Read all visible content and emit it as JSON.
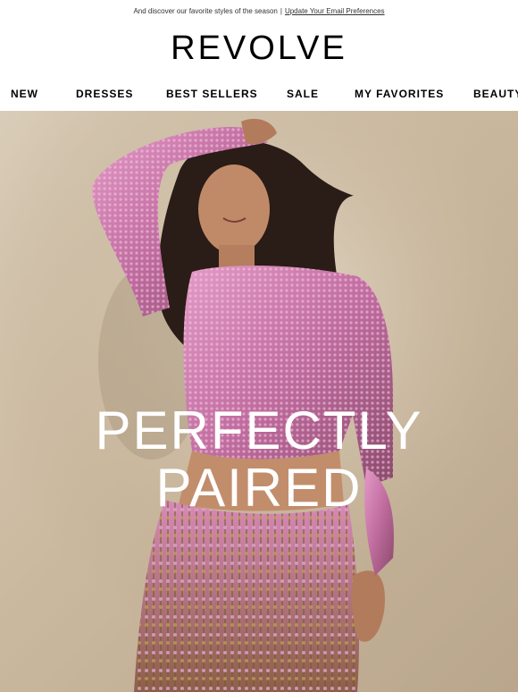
{
  "preheader": {
    "text": "And discover our favorite styles of the season",
    "separator": "|",
    "link": "Update Your Email Preferences"
  },
  "brand": {
    "logo": "REVOLVE"
  },
  "nav": {
    "items": [
      "NEW",
      "DRESSES",
      "BEST SELLERS",
      "SALE",
      "MY FAVORITES",
      "BEAUTY"
    ]
  },
  "hero": {
    "headline_line1": "PERFECTLY",
    "headline_line2": "PAIRED",
    "image": "model-in-pink-sequin-crop-top-and-fringe-skirt",
    "background_color": "#cbb99f",
    "accent_color": "#c77aa8"
  }
}
